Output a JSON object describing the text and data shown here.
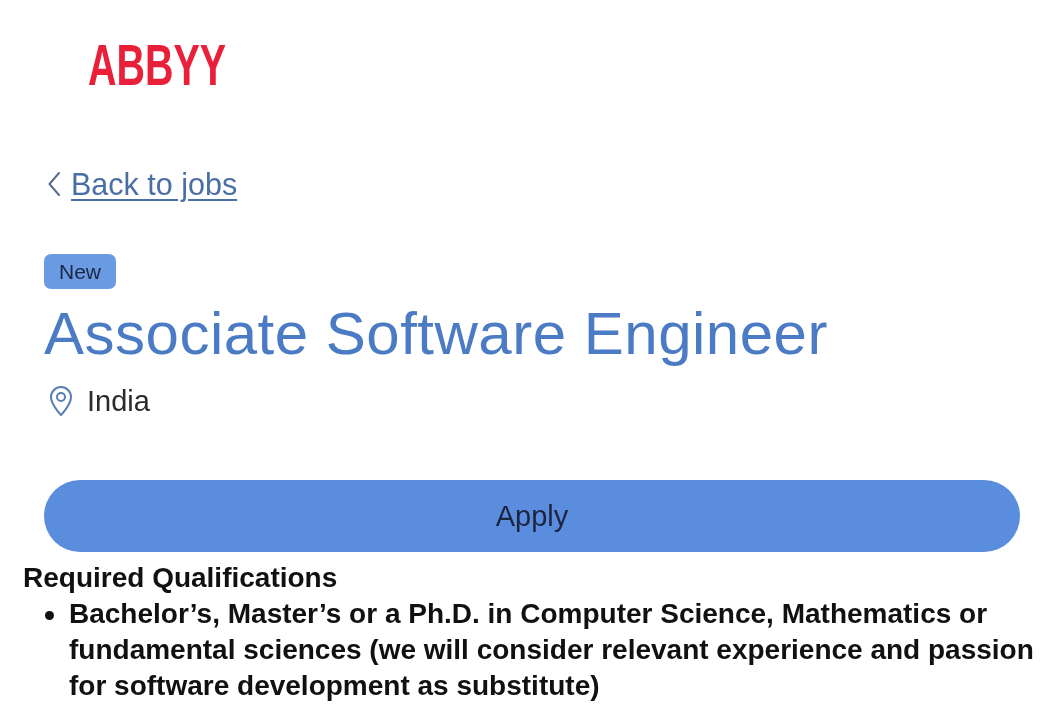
{
  "header": {
    "logo": "ABBYY"
  },
  "back_link": {
    "label": "Back to jobs"
  },
  "job": {
    "badge": "New",
    "title": "Associate Software Engineer",
    "location": "India"
  },
  "apply_button": {
    "label": "Apply"
  },
  "qualifications": {
    "heading": "Required Qualifications",
    "items": [
      "Bachelor’s, Master’s or a Ph.D. in Computer Science, Mathematics or fundamental sciences (we will consider relevant experience and passion for software development as substitute)"
    ]
  }
}
